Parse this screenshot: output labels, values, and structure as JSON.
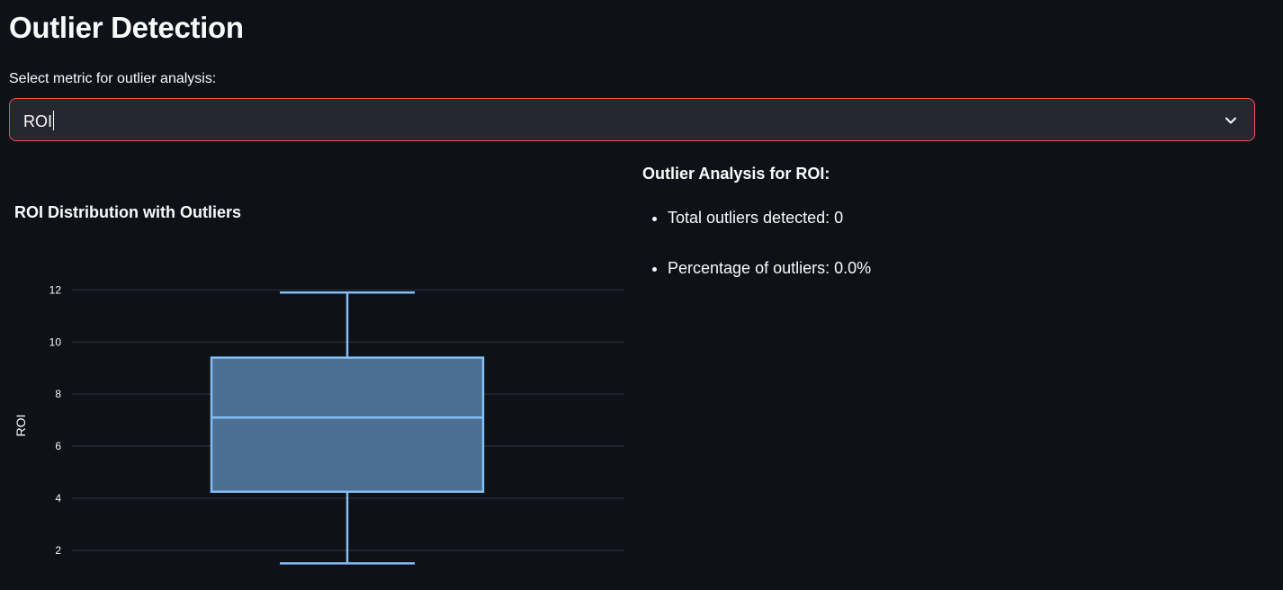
{
  "page": {
    "title": "Outlier Detection"
  },
  "metric_select": {
    "label": "Select metric for outlier analysis:",
    "value": "ROI",
    "icon": "chevron-down-icon",
    "border_color": "#ff4b4b"
  },
  "analysis": {
    "title": "Outlier Analysis for ROI:",
    "items": [
      {
        "text": "Total outliers detected: 0"
      },
      {
        "text": "Percentage of outliers: 0.0%"
      }
    ]
  },
  "chart_data": {
    "type": "box",
    "title": "ROI Distribution with Outliers",
    "ylabel": "ROI",
    "xlabel": "",
    "ylim": [
      1.2,
      12.6
    ],
    "yticks": [
      2,
      4,
      6,
      8,
      10,
      12
    ],
    "grid": true,
    "box": {
      "min": 1.5,
      "q1": 4.25,
      "median": 7.1,
      "q3": 9.4,
      "max": 11.9
    },
    "colors": {
      "line": "#82bdf5",
      "fill": "#4a6f92",
      "grid": "#31353f",
      "tick_text": "#fafafa"
    }
  }
}
